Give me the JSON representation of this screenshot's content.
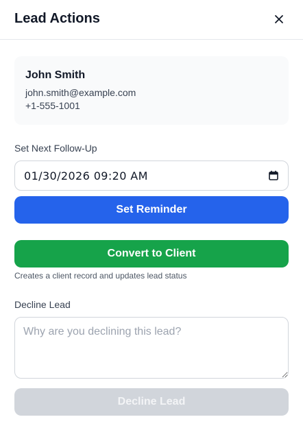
{
  "header": {
    "title": "Lead Actions",
    "close_icon": "close-icon"
  },
  "lead": {
    "name": "John Smith",
    "email": "john.smith@example.com",
    "phone": "+1-555-1001"
  },
  "follow_up": {
    "label": "Set Next Follow-Up",
    "value": "01/30/2026 09:20 AM",
    "calendar_icon": "calendar-icon",
    "button_label": "Set Reminder"
  },
  "convert": {
    "button_label": "Convert to Client",
    "hint": "Creates a client record and updates lead status"
  },
  "decline": {
    "label": "Decline Lead",
    "placeholder": "Why are you declining this lead?",
    "button_label": "Decline Lead"
  },
  "colors": {
    "primary_blue": "#2563eb",
    "success_green": "#16a34a",
    "disabled_gray": "#d1d5db"
  }
}
